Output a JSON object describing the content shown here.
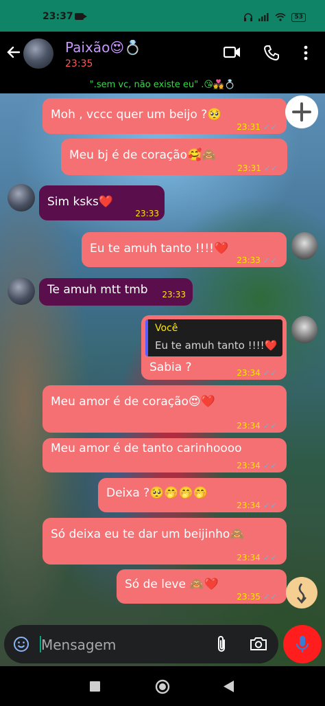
{
  "status_bar": {
    "time": "23:37",
    "battery": "53"
  },
  "header": {
    "contact_name": "Paixão😍💍",
    "last_seen": "23:35",
    "status_line": "\".sem vc, não existe eu\" .😘💑💍"
  },
  "messages": [
    {
      "dir": "out",
      "text": "Moh , vccc quer um beijo ?🥺",
      "time": "23:31"
    },
    {
      "dir": "out",
      "text": "Meu bj é de coração🥰🙈",
      "time": "23:31"
    },
    {
      "dir": "in",
      "text": "Sim ksks❤️",
      "time": "23:33"
    },
    {
      "dir": "out",
      "text": "Eu te amuh tanto !!!!❤️",
      "time": "23:33"
    },
    {
      "dir": "in",
      "text": "Te amuh mtt tmb",
      "time": "23:33"
    },
    {
      "dir": "out",
      "text": "Sabia ?",
      "time": "23:34",
      "reply_name": "Você",
      "reply_text": "Eu te amuh tanto !!!!❤️"
    },
    {
      "dir": "out",
      "text": "Meu amor é de coração😍❤️",
      "time": "23:34"
    },
    {
      "dir": "out",
      "text": "Meu amor é de tanto carinhoooo",
      "time": "23:34"
    },
    {
      "dir": "out",
      "text": "Deixa ?🥺🤭🤭🤭",
      "time": "23:34"
    },
    {
      "dir": "out",
      "text": "Só deixa eu te dar um beijinho🙈",
      "time": "23:34"
    },
    {
      "dir": "out",
      "text": "Só de leve 🙈❤️",
      "time": "23:35"
    }
  ],
  "composer": {
    "placeholder": "Mensagem"
  },
  "colors": {
    "outgoing": "#f57073",
    "incoming": "#5a0e4c",
    "time": "#ffe600",
    "mic": "#ff1d1d",
    "accent_green": "#0f8466"
  },
  "icons": [
    "back-arrow-icon",
    "video-call-icon",
    "phone-icon",
    "more-icon",
    "plus-icon",
    "scroll-down-icon",
    "emoji-icon",
    "attach-icon",
    "camera-icon",
    "mic-icon",
    "nav-back-icon",
    "nav-home-icon",
    "nav-recents-icon"
  ]
}
